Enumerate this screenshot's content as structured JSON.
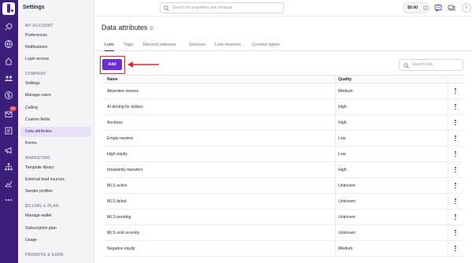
{
  "sidebar": {
    "title": "Settings",
    "sections": [
      {
        "label": "MY ACCOUNT",
        "items": [
          {
            "label": "Preferences"
          },
          {
            "label": "Notifications"
          },
          {
            "label": "Login access"
          }
        ]
      },
      {
        "label": "COMPANY",
        "items": [
          {
            "label": "Settings"
          },
          {
            "label": "Manage users"
          },
          {
            "label": "Calling"
          },
          {
            "label": "Custom fields"
          },
          {
            "label": "Data attributes"
          },
          {
            "label": "Forms"
          }
        ]
      },
      {
        "label": "MARKETING",
        "items": [
          {
            "label": "Template library"
          },
          {
            "label": "External lead sources"
          },
          {
            "label": "Sender profiles"
          }
        ]
      },
      {
        "label": "BILLING & PLAN",
        "items": [
          {
            "label": "Manage wallet"
          },
          {
            "label": "Subscription plan"
          },
          {
            "label": "Usage"
          }
        ]
      },
      {
        "label": "PROMOTE & EARN",
        "items": []
      }
    ],
    "active_item": "Data attributes"
  },
  "rail": {
    "badge": "28",
    "icons": [
      "rocket-icon",
      "globe-icon",
      "home-icon",
      "people-icon",
      "dollar-icon",
      "inbox-icon",
      "list-icon",
      "megaphone-icon",
      "network-icon",
      "chart-icon",
      "more-icon"
    ]
  },
  "header": {
    "search_placeholder": "Search for properties and contacts",
    "wallet_balance": "$0.00",
    "avatar_initial": "I"
  },
  "page": {
    "title": "Data attributes",
    "tabs": [
      {
        "label": "Lists",
        "active": true
      },
      {
        "label": "Tags"
      },
      {
        "label": "Record statuses"
      },
      {
        "label": "Sources"
      },
      {
        "label": "Lost reasons"
      },
      {
        "label": "Contact types"
      }
    ],
    "add_label": "Add",
    "list_search_placeholder": "Search lists"
  },
  "table": {
    "columns": [
      "Name",
      "Quality"
    ],
    "rows": [
      {
        "name": "Absentee owners",
        "quality": "Medium"
      },
      {
        "name": "AI driving for dollars",
        "quality": "High"
      },
      {
        "name": "Auctions",
        "quality": "High"
      },
      {
        "name": "Empty nesters",
        "quality": "Low"
      },
      {
        "name": "High equity",
        "quality": "Low"
      },
      {
        "name": "Intrafamily transfers",
        "quality": "High"
      },
      {
        "name": "MLS active",
        "quality": "Unknown"
      },
      {
        "name": "MLS failed",
        "quality": "Unknown"
      },
      {
        "name": "MLS pending",
        "quality": "Unknown"
      },
      {
        "name": "MLS sold recently",
        "quality": "Unknown"
      },
      {
        "name": "Negative equity",
        "quality": "Medium"
      }
    ]
  },
  "colors": {
    "rail": "#3b1d7a",
    "accent": "#6c2bd9",
    "highlight": "#e0241c",
    "active_item_bg": "#e7e0f7"
  }
}
